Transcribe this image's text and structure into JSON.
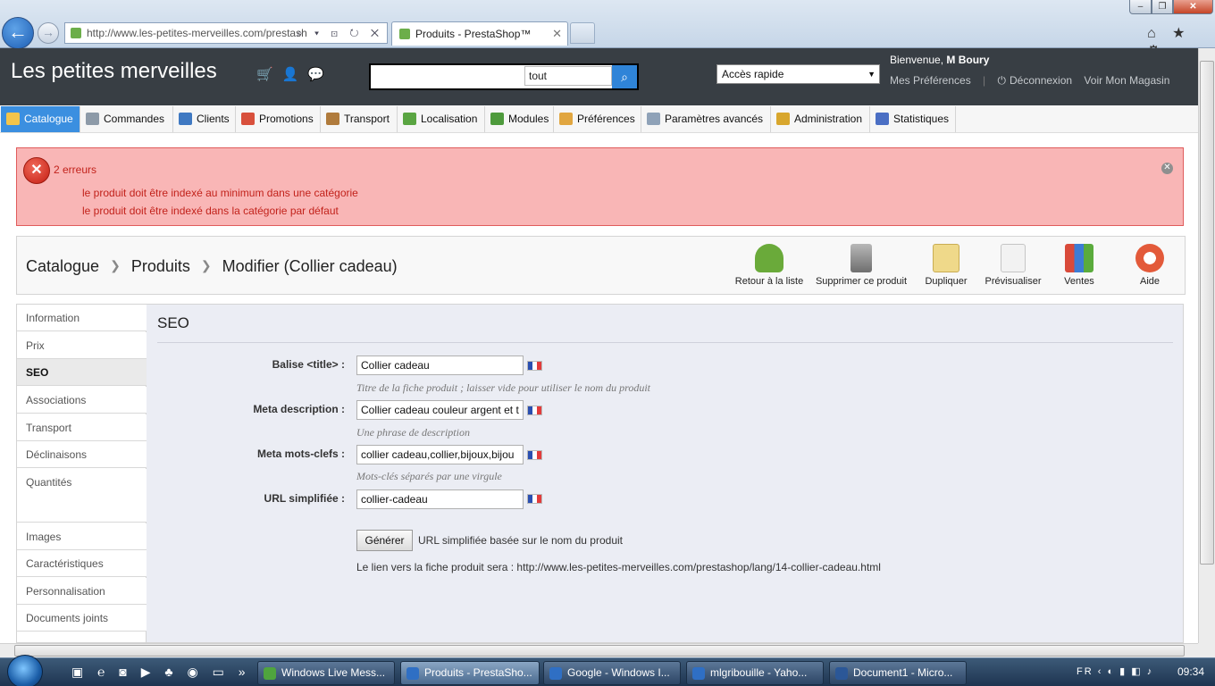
{
  "browser": {
    "url": "http://www.les-petites-merveilles.com/prestash",
    "tab_title": "Produits - PrestaShop™",
    "tab_close": "✕",
    "back": "←",
    "forward": "→",
    "address_ctrls": "⌕ ▾ ⊡ ↻ ✕",
    "tools": "⌂ ★ ⚙"
  },
  "header": {
    "shop_title": "Les petites merveilles",
    "icons": [
      "cart-icon",
      "customers-icon",
      "messages-icon"
    ],
    "search_value": "",
    "search_type": "tout",
    "quick_access": "Accès rapide",
    "welcome_prefix": "Bienvenue,",
    "welcome_user": "M Boury",
    "link_prefs": "Mes Préférences",
    "link_logout": "Déconnexion",
    "link_store": "Voir Mon Magasin"
  },
  "nav": [
    {
      "label": "Catalogue",
      "icon": "folder-icon",
      "color": "#f3c44b"
    },
    {
      "label": "Commandes",
      "icon": "cart-icon",
      "color": "#8d9aa8"
    },
    {
      "label": "Clients",
      "icon": "user-icon",
      "color": "#3f79c2"
    },
    {
      "label": "Promotions",
      "icon": "tag-icon",
      "color": "#d8503c"
    },
    {
      "label": "Transport",
      "icon": "truck-icon",
      "color": "#b07b3c"
    },
    {
      "label": "Localisation",
      "icon": "globe-icon",
      "color": "#5aa542"
    },
    {
      "label": "Modules",
      "icon": "puzzle-icon",
      "color": "#4e9a3c"
    },
    {
      "label": "Préférences",
      "icon": "settings-icon",
      "color": "#e1a640"
    },
    {
      "label": "Paramètres avancés",
      "icon": "wrench-icon",
      "color": "#8fa2b8"
    },
    {
      "label": "Administration",
      "icon": "key-icon",
      "color": "#d8a62d"
    },
    {
      "label": "Statistiques",
      "icon": "stats-icon",
      "color": "#4b6fc4"
    }
  ],
  "errors": {
    "title": "2 erreurs",
    "items": [
      "le produit doit être indexé au minimum dans une catégorie",
      "le produit doit être indexé dans la catégorie par défaut"
    ]
  },
  "breadcrumb": [
    "Catalogue",
    "Produits",
    "Modifier (Collier cadeau)"
  ],
  "toolbar": [
    {
      "label": "Retour à la liste",
      "icon": "back-arrow-icon",
      "color": "#6aaa3a"
    },
    {
      "label": "Supprimer ce produit",
      "icon": "trash-icon",
      "color": "#7d7d7d"
    },
    {
      "label": "Dupliquer",
      "icon": "duplicate-icon",
      "color": "#e9cf7a"
    },
    {
      "label": "Prévisualiser",
      "icon": "preview-icon",
      "color": "#c8d4e0"
    },
    {
      "label": "Ventes",
      "icon": "sales-chart-icon",
      "color": "#d94a3a"
    },
    {
      "label": "Aide",
      "icon": "help-lifebuoy-icon",
      "color": "#e35a3a"
    }
  ],
  "sidebar": [
    "Information",
    "Prix",
    "SEO",
    "Associations",
    "Transport",
    "Déclinaisons",
    "Quantités",
    "Images",
    "Caractéristiques",
    "Personnalisation",
    "Documents joints"
  ],
  "seo": {
    "title": "SEO",
    "fields": [
      {
        "label": "Balise <title> :",
        "value": "Collier cadeau",
        "hint": "Titre de la fiche produit ; laisser vide pour utiliser le nom du produit"
      },
      {
        "label": "Meta description :",
        "value": "Collier cadeau couleur argent et t",
        "hint": "Une phrase de description"
      },
      {
        "label": "Meta mots-clefs :",
        "value": "collier cadeau,collier,bijoux,bijou",
        "hint": "Mots-clés séparés par une virgule"
      },
      {
        "label": "URL simplifiée :",
        "value": "collier-cadeau",
        "hint": ""
      }
    ],
    "generate_button": "Générer",
    "generate_label": "URL simplifiée basée sur le nom du produit",
    "link_text": "Le lien vers la fiche produit sera : http://www.les-petites-merveilles.com/prestashop/lang/14-collier-cadeau.html"
  },
  "taskbar": {
    "tasks": [
      {
        "label": "Windows Live Mess...",
        "color": "#4fa43e"
      },
      {
        "label": "Produits - PrestaSho...",
        "color": "#2f6fc4"
      },
      {
        "label": "Google - Windows I...",
        "color": "#2f6fc4"
      },
      {
        "label": "mlgribouille - Yaho...",
        "color": "#2f6fc4"
      },
      {
        "label": "Document1 - Micro...",
        "color": "#2b5797"
      }
    ],
    "lang": "FR",
    "clock": "09:34"
  }
}
